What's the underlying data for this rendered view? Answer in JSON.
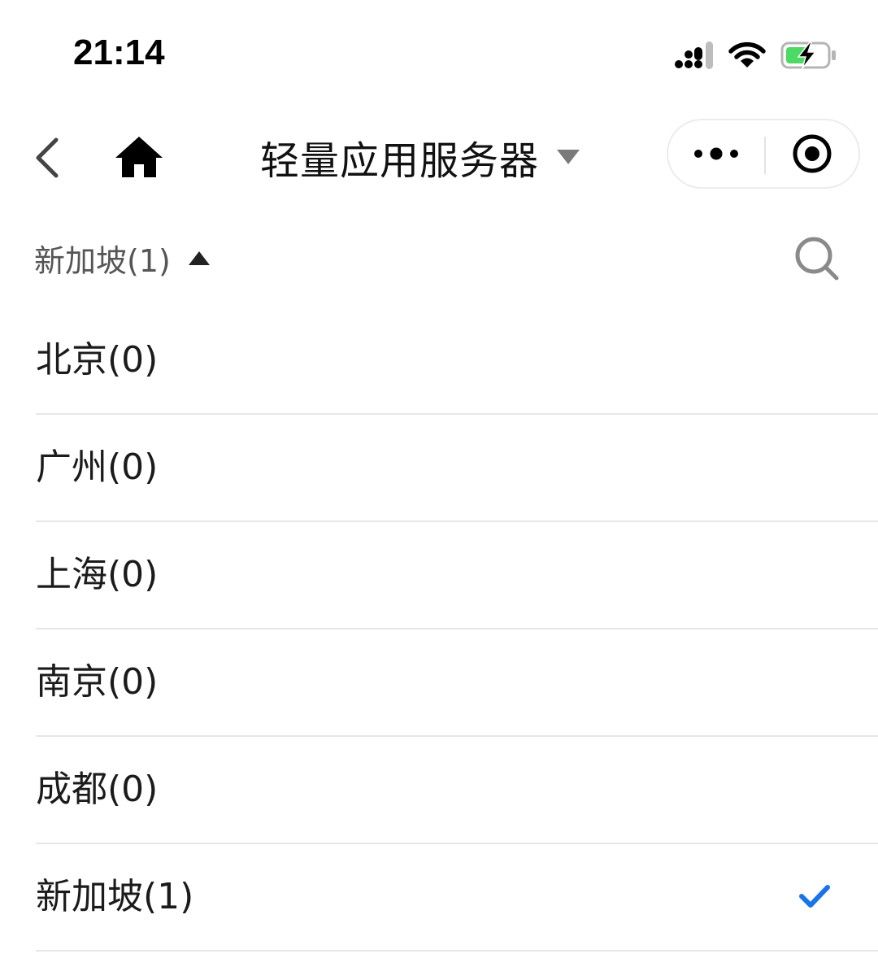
{
  "status_bar": {
    "time": "21:14",
    "icons": [
      "cellular-signal-icon",
      "wifi-icon",
      "battery-charging-icon"
    ],
    "battery_color": "#4cd964"
  },
  "nav": {
    "title": "轻量应用服务器",
    "back_icon": "chevron-left-icon",
    "home_icon": "home-icon",
    "more_icon": "more-dots-icon",
    "close_icon": "target-close-icon"
  },
  "region_header": {
    "current": "新加坡(1)",
    "search_icon": "search-icon"
  },
  "regions": [
    {
      "label": "北京(0)",
      "selected": false
    },
    {
      "label": "广州(0)",
      "selected": false
    },
    {
      "label": "上海(0)",
      "selected": false
    },
    {
      "label": "南京(0)",
      "selected": false
    },
    {
      "label": "成都(0)",
      "selected": false
    },
    {
      "label": "新加坡(1)",
      "selected": true
    }
  ],
  "colors": {
    "accent": "#1a73e8",
    "divider": "#e6e6e6",
    "caret": "#7a7a7a"
  }
}
